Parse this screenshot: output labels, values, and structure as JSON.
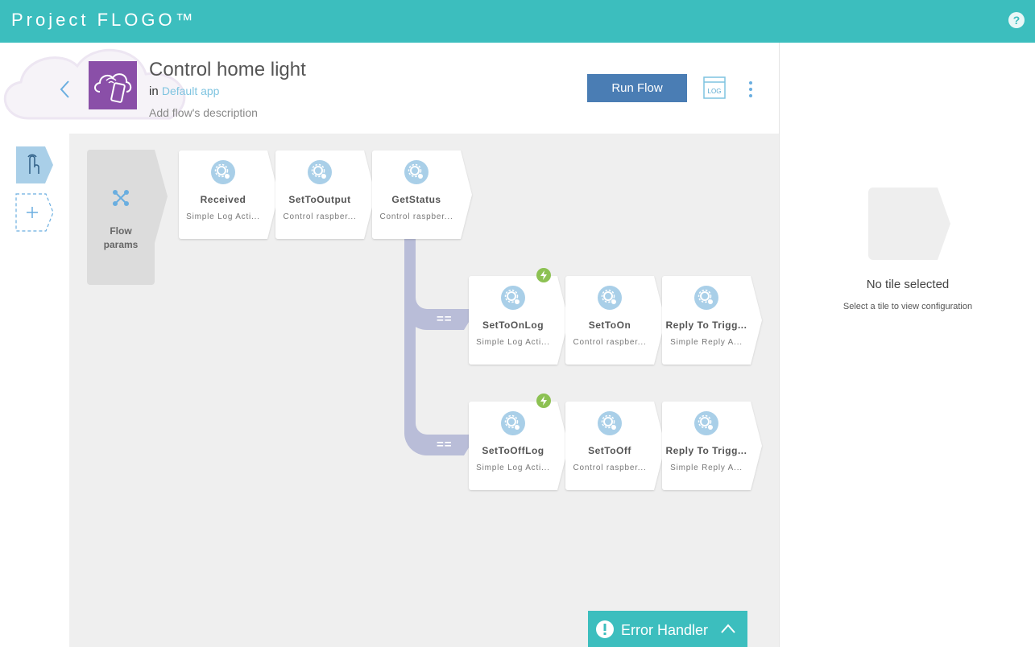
{
  "topbar": {
    "brand": "Project FLOGO™",
    "help_label": "?"
  },
  "header": {
    "flow_title": "Control home light",
    "in_prefix": "in",
    "app_name": "Default app",
    "description_placeholder": "Add flow's description",
    "run_flow_label": "Run Flow",
    "log_icon_text": "LOG"
  },
  "colors": {
    "brand": "#3cbebe",
    "run_button": "#4a7db4",
    "app_icon": "#8a4fa8",
    "branch": "#b9bdd8",
    "bolt": "#8cc152"
  },
  "flow_params": {
    "label_line1": "Flow",
    "label_line2": "params"
  },
  "tiles_main": [
    {
      "name": "Received",
      "subtitle": "Simple Log Acti..."
    },
    {
      "name": "SetToOutput",
      "subtitle": "Control raspber..."
    },
    {
      "name": "GetStatus",
      "subtitle": "Control raspber..."
    }
  ],
  "branch_on": {
    "condition": "==",
    "tiles": [
      {
        "name": "SetToOnLog",
        "subtitle": "Simple Log Acti..."
      },
      {
        "name": "SetToOn",
        "subtitle": "Control raspber..."
      },
      {
        "name": "Reply To Trigg...",
        "subtitle": "Simple Reply A..."
      }
    ]
  },
  "branch_off": {
    "condition": "==",
    "tiles": [
      {
        "name": "SetToOffLog",
        "subtitle": "Simple Log Acti..."
      },
      {
        "name": "SetToOff",
        "subtitle": "Control raspber..."
      },
      {
        "name": "Reply To Trigg...",
        "subtitle": "Simple Reply A..."
      }
    ]
  },
  "error_handler": {
    "label": "Error Handler"
  },
  "right_panel": {
    "no_tile_title": "No tile selected",
    "no_tile_hint": "Select a tile to view configuration"
  }
}
